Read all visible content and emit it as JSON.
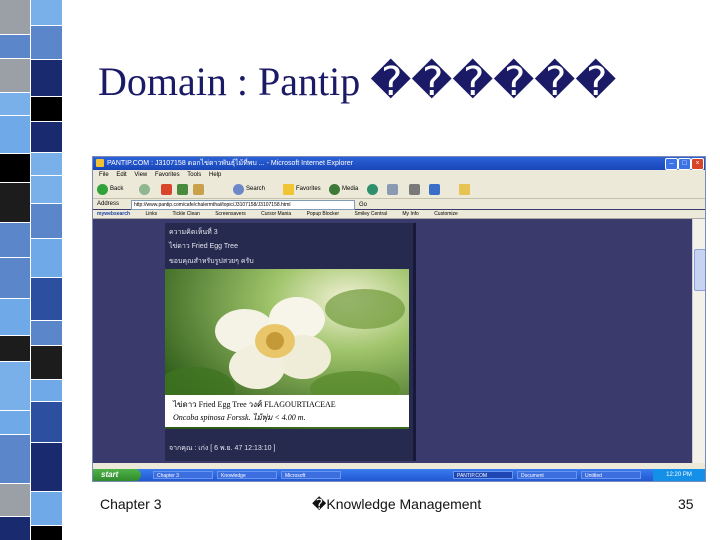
{
  "slide": {
    "title": "Domain : Pantip ������",
    "footer_left": "Chapter 3",
    "footer_center": "�Knowledge Management",
    "footer_right": "35"
  },
  "browser": {
    "window_title": "PANTIP.COM : J3107158 ดอกไข่ดาวพันธุ์ไม้ที่พบ ... - Microsoft Internet Explorer",
    "menu": [
      "File",
      "Edit",
      "View",
      "Favorites",
      "Tools",
      "Help"
    ],
    "toolbar": {
      "back": "Back",
      "search": "Search",
      "favorites": "Favorites",
      "media": "Media"
    },
    "address_label": "Address",
    "address_value": "http://www.pantip.com/cafe/chalermthai/topic/J3107158/J3107158.html",
    "go_label": "Go",
    "links": [
      "Links",
      "Tickle Clean",
      "Screensavers",
      "Cursor Mania",
      "Popup Blocker",
      "Smiley Central",
      "My Info",
      "Customize"
    ],
    "brand": "mywebsearch"
  },
  "post": {
    "header": "ความคิดเห็นที่ 3",
    "line1": "ไข่ดาว Fried Egg Tree",
    "line2": "ขอบคุณสำหรับรูปสวยๆ ครับ",
    "caption_line1": "ไข่ดาว Fried Egg Tree วงศ์ FLAGOURTIACEAE",
    "caption_line2": "Oncoba spinosa Forssk. ไม้พุ่ม < 4.00 m.",
    "signature": "จากคุณ : เก่ง [ 6 พ.ย. 47 12:13:10 ]"
  },
  "taskbar": {
    "start": "start",
    "tasks": [
      "Chapter 3",
      "Knowledge",
      "Microsoft",
      "PANTIP.COM",
      "Document",
      "Untitled"
    ],
    "clock": "12:20 PM"
  },
  "colors": {
    "slide_title": "#1a1a66",
    "page_bg": "#3b3a6d",
    "titlebar": "#2c62d8"
  }
}
